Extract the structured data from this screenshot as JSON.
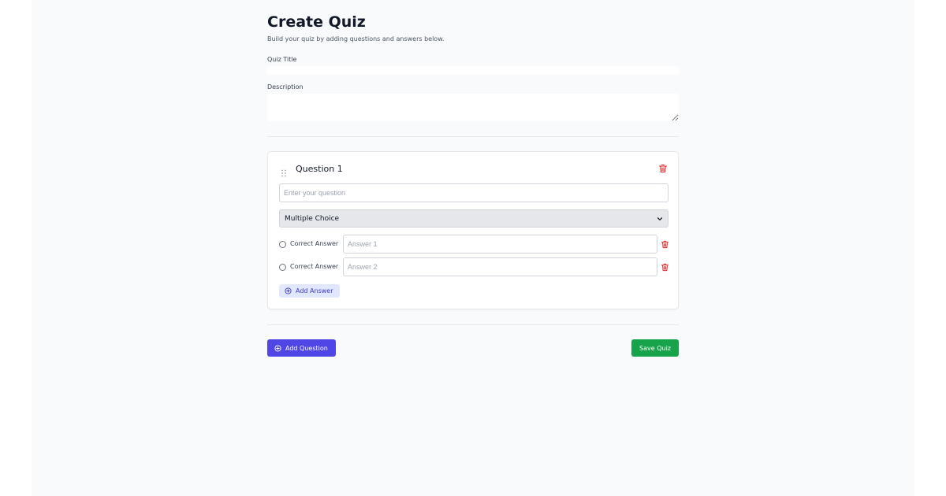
{
  "header": {
    "title": "Create Quiz",
    "subtitle": "Build your quiz by adding questions and answers below."
  },
  "form": {
    "quiz_title_label": "Quiz Title",
    "quiz_title_value": "",
    "description_label": "Description",
    "description_value": ""
  },
  "question": {
    "heading": "Question 1",
    "placeholder": "Enter your question",
    "value": "",
    "type_selected": "Multiple Choice",
    "answers": [
      {
        "radio_label": "Correct Answer",
        "placeholder": "Answer 1",
        "value": ""
      },
      {
        "radio_label": "Correct Answer",
        "placeholder": "Answer 2",
        "value": ""
      }
    ],
    "add_answer_label": "Add Answer"
  },
  "actions": {
    "add_question_label": "Add Question",
    "save_quiz_label": "Save Quiz"
  },
  "icons": {
    "drag": "drag-handle-icon",
    "delete": "trash-icon",
    "add": "plus-circle-icon",
    "dropdown": "chevron-down-icon"
  },
  "colors": {
    "primary": "#4f46e5",
    "primary_light": "#e0e7ff",
    "success": "#16a34a",
    "danger": "#dc2626",
    "page_background": "#f9fafb"
  }
}
